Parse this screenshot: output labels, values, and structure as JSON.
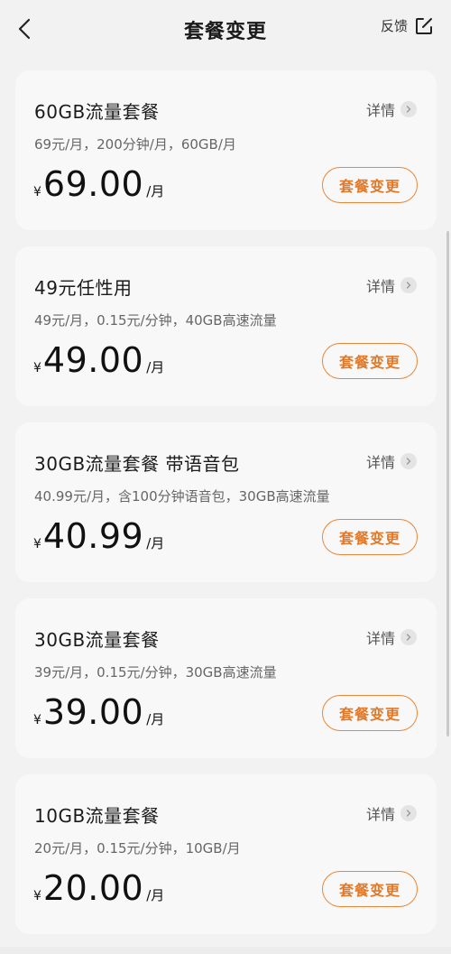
{
  "header": {
    "title": "套餐变更",
    "feedback_label": "反馈"
  },
  "plans": [
    {
      "name": "60GB流量套餐",
      "detail_label": "详情",
      "description": "69元/月，200分钟/月，60GB/月",
      "currency": "¥",
      "price": "69.00",
      "unit": "/月",
      "button_label": "套餐变更"
    },
    {
      "name": "49元任性用",
      "detail_label": "详情",
      "description": "49元/月，0.15元/分钟，40GB高速流量",
      "currency": "¥",
      "price": "49.00",
      "unit": "/月",
      "button_label": "套餐变更"
    },
    {
      "name": "30GB流量套餐 带语音包",
      "detail_label": "详情",
      "description": "40.99元/月，含100分钟语音包，30GB高速流量",
      "currency": "¥",
      "price": "40.99",
      "unit": "/月",
      "button_label": "套餐变更"
    },
    {
      "name": "30GB流量套餐",
      "detail_label": "详情",
      "description": "39元/月，0.15元/分钟，30GB高速流量",
      "currency": "¥",
      "price": "39.00",
      "unit": "/月",
      "button_label": "套餐变更"
    },
    {
      "name": "10GB流量套餐",
      "detail_label": "详情",
      "description": "20元/月，0.15元/分钟，10GB/月",
      "currency": "¥",
      "price": "20.00",
      "unit": "/月",
      "button_label": "套餐变更"
    }
  ],
  "colors": {
    "accent": "#e07a2a",
    "card_bg": "#f8f8f8",
    "page_bg": "#f2f2f2"
  },
  "icons": {
    "back": "chevron-left-icon",
    "feedback": "edit-icon",
    "detail": "chevron-right-icon"
  }
}
